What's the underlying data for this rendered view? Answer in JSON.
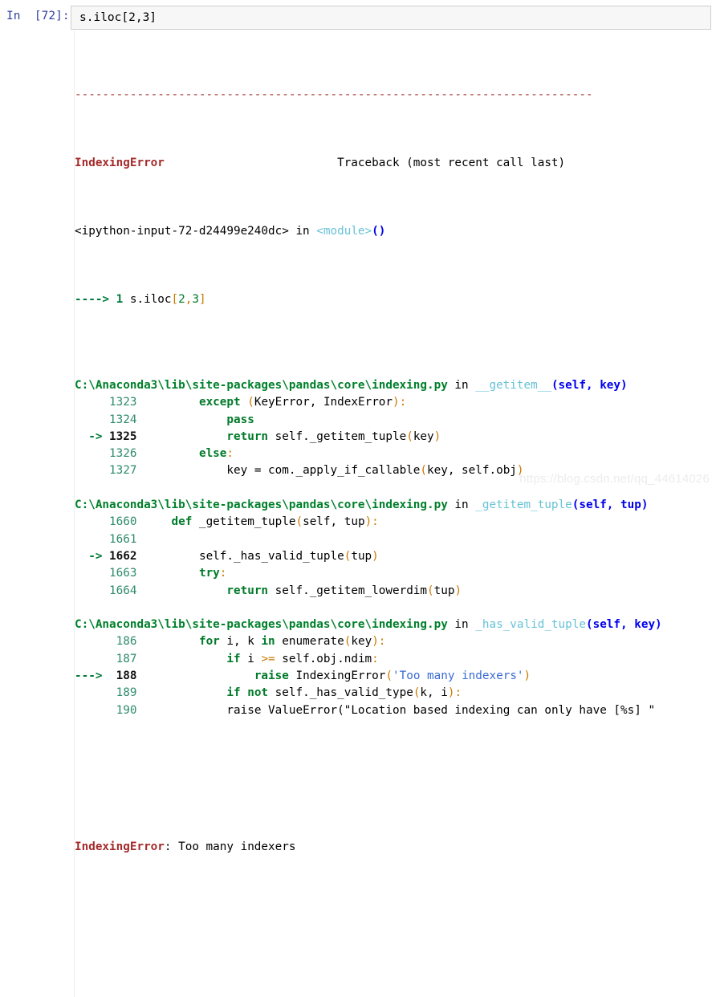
{
  "notebook": {
    "input_prompt": "In  [72]:",
    "input_code": "s.iloc[2,3]"
  },
  "traceback": {
    "separator": "---------------------------------------------------------------------------",
    "exception_name": "IndexingError",
    "header_note": "Traceback (most recent call last)",
    "cell_frame": {
      "location": "<ipython-input-72-d24499e240dc>",
      "in_word": "in",
      "scope": "<module>",
      "scope_parens": "()",
      "arrow": "---->",
      "lineno": "1",
      "code_prefix": "s.iloc",
      "code_open": "[",
      "code_a": "2",
      "code_comma": ",",
      "code_b": "3",
      "code_close": "]"
    },
    "frames": [
      {
        "path": "C:\\Anaconda3\\lib\\site-packages\\pandas\\core\\indexing.py",
        "in_word": "in",
        "function": "__getitem__",
        "signature": "(self, key)",
        "lines": [
          {
            "arrow": "",
            "no": "1323",
            "indent": "        ",
            "current": false,
            "tokens": [
              {
                "t": "except",
                "c": "kw"
              },
              {
                "t": " ",
                "c": "plain"
              },
              {
                "t": "(",
                "c": "punct"
              },
              {
                "t": "KeyError",
                "c": "name"
              },
              {
                "t": ", ",
                "c": "plain"
              },
              {
                "t": "IndexError",
                "c": "name"
              },
              {
                "t": ")",
                "c": "punct"
              },
              {
                "t": ":",
                "c": "punct"
              }
            ]
          },
          {
            "arrow": "",
            "no": "1324",
            "indent": "            ",
            "current": false,
            "tokens": [
              {
                "t": "pass",
                "c": "kw"
              }
            ]
          },
          {
            "arrow": "->",
            "no": "1325",
            "indent": "            ",
            "current": true,
            "tokens": [
              {
                "t": "return",
                "c": "kw"
              },
              {
                "t": " self._getitem_tuple",
                "c": "name"
              },
              {
                "t": "(",
                "c": "punct"
              },
              {
                "t": "key",
                "c": "name"
              },
              {
                "t": ")",
                "c": "punct"
              }
            ]
          },
          {
            "arrow": "",
            "no": "1326",
            "indent": "        ",
            "current": false,
            "tokens": [
              {
                "t": "else",
                "c": "kw"
              },
              {
                "t": ":",
                "c": "punct"
              }
            ]
          },
          {
            "arrow": "",
            "no": "1327",
            "indent": "            ",
            "current": false,
            "tokens": [
              {
                "t": "key = com._apply_if_callable",
                "c": "name"
              },
              {
                "t": "(",
                "c": "punct"
              },
              {
                "t": "key, self.obj",
                "c": "name"
              },
              {
                "t": ")",
                "c": "punct"
              }
            ]
          }
        ]
      },
      {
        "path": "C:\\Anaconda3\\lib\\site-packages\\pandas\\core\\indexing.py",
        "in_word": "in",
        "function": "_getitem_tuple",
        "signature": "(self, tup)",
        "lines": [
          {
            "arrow": "",
            "no": "1660",
            "indent": "    ",
            "current": false,
            "tokens": [
              {
                "t": "def",
                "c": "kw"
              },
              {
                "t": " _getitem_tuple",
                "c": "name"
              },
              {
                "t": "(",
                "c": "punct"
              },
              {
                "t": "self, tup",
                "c": "name"
              },
              {
                "t": ")",
                "c": "punct"
              },
              {
                "t": ":",
                "c": "punct"
              }
            ]
          },
          {
            "arrow": "",
            "no": "1661",
            "indent": "",
            "current": false,
            "tokens": []
          },
          {
            "arrow": "->",
            "no": "1662",
            "indent": "        ",
            "current": true,
            "tokens": [
              {
                "t": "self._has_valid_tuple",
                "c": "name"
              },
              {
                "t": "(",
                "c": "punct"
              },
              {
                "t": "tup",
                "c": "name"
              },
              {
                "t": ")",
                "c": "punct"
              }
            ]
          },
          {
            "arrow": "",
            "no": "1663",
            "indent": "        ",
            "current": false,
            "tokens": [
              {
                "t": "try",
                "c": "kw"
              },
              {
                "t": ":",
                "c": "punct"
              }
            ]
          },
          {
            "arrow": "",
            "no": "1664",
            "indent": "            ",
            "current": false,
            "tokens": [
              {
                "t": "return",
                "c": "kw"
              },
              {
                "t": " self._getitem_lowerdim",
                "c": "name"
              },
              {
                "t": "(",
                "c": "punct"
              },
              {
                "t": "tup",
                "c": "name"
              },
              {
                "t": ")",
                "c": "punct"
              }
            ]
          }
        ]
      },
      {
        "path": "C:\\Anaconda3\\lib\\site-packages\\pandas\\core\\indexing.py",
        "in_word": "in",
        "function": "_has_valid_tuple",
        "signature": "(self, key)",
        "lines": [
          {
            "arrow": "",
            "no": "186",
            "indent": "        ",
            "current": false,
            "tokens": [
              {
                "t": "for",
                "c": "kw"
              },
              {
                "t": " i, k ",
                "c": "name"
              },
              {
                "t": "in",
                "c": "kw"
              },
              {
                "t": " enumerate",
                "c": "name"
              },
              {
                "t": "(",
                "c": "punct"
              },
              {
                "t": "key",
                "c": "name"
              },
              {
                "t": ")",
                "c": "punct"
              },
              {
                "t": ":",
                "c": "punct"
              }
            ]
          },
          {
            "arrow": "",
            "no": "187",
            "indent": "            ",
            "current": false,
            "tokens": [
              {
                "t": "if",
                "c": "kw"
              },
              {
                "t": " i ",
                "c": "name"
              },
              {
                "t": ">=",
                "c": "punct"
              },
              {
                "t": " self.obj.ndim",
                "c": "name"
              },
              {
                "t": ":",
                "c": "punct"
              }
            ]
          },
          {
            "arrow": "--->",
            "no": "188",
            "indent": "                ",
            "current": true,
            "tokens": [
              {
                "t": "raise",
                "c": "kw"
              },
              {
                "t": " IndexingError",
                "c": "name"
              },
              {
                "t": "(",
                "c": "punct"
              },
              {
                "t": "'Too many indexers'",
                "c": "str"
              },
              {
                "t": ")",
                "c": "punct"
              }
            ]
          },
          {
            "arrow": "",
            "no": "189",
            "indent": "            ",
            "current": false,
            "tokens": [
              {
                "t": "if",
                "c": "kw"
              },
              {
                "t": " ",
                "c": "plain"
              },
              {
                "t": "not",
                "c": "kw"
              },
              {
                "t": " self._has_valid_type",
                "c": "name"
              },
              {
                "t": "(",
                "c": "punct"
              },
              {
                "t": "k, i",
                "c": "name"
              },
              {
                "t": ")",
                "c": "punct"
              },
              {
                "t": ":",
                "c": "punct"
              }
            ]
          },
          {
            "arrow": "",
            "no": "190",
            "indent": "            ",
            "current": false,
            "tokens": [
              {
                "t": "raise ValueError(\"Location based indexing can only have [%s] \"",
                "c": "name"
              }
            ]
          }
        ]
      }
    ],
    "final_exception": "IndexingError",
    "final_message": ": Too many indexers"
  },
  "watermark": "https://blog.csdn.net/qq_44614026"
}
